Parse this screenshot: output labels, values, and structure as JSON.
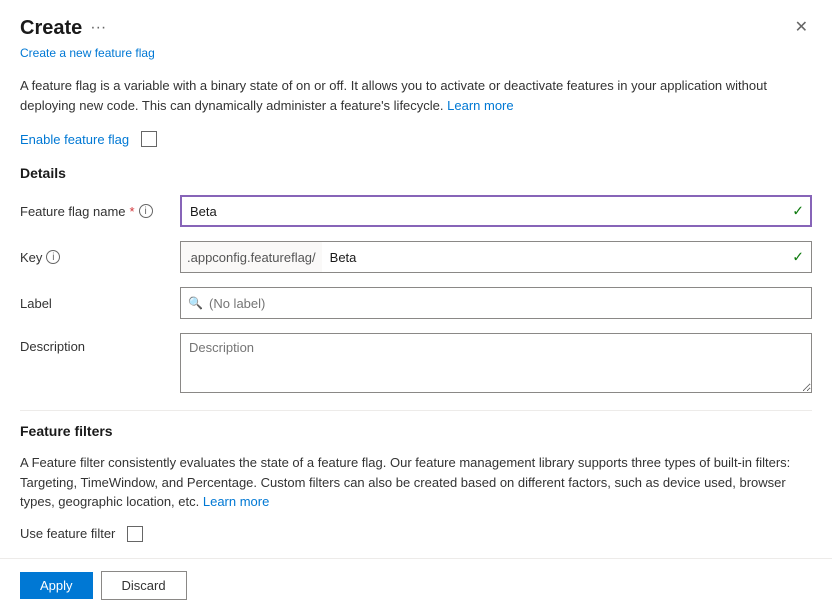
{
  "dialog": {
    "title": "Create",
    "subtitle": "Create a new feature flag",
    "more_icon": "···",
    "close_icon": "✕",
    "description": "A feature flag is a variable with a binary state of on or off. It allows you to activate or deactivate features in your application without deploying new code. This can dynamically administer a feature's lifecycle.",
    "learn_more_link": "Learn more",
    "enable_feature_flag_label": "Enable feature flag",
    "details_section": "Details",
    "feature_flag_name_label": "Feature flag name",
    "feature_flag_name_required": "*",
    "feature_flag_name_value": "Beta",
    "key_label": "Key",
    "key_prefix": ".appconfig.featureflag/",
    "key_value": "Beta",
    "label_label": "Label",
    "label_placeholder": "(No label)",
    "description_label": "Description",
    "description_placeholder": "Description",
    "feature_filters_title": "Feature filters",
    "feature_filters_description": "A Feature filter consistently evaluates the state of a feature flag. Our feature management library supports three types of built-in filters: Targeting, TimeWindow, and Percentage. Custom filters can also be created based on different factors, such as device used, browser types, geographic location, etc.",
    "feature_filters_learn_more": "Learn more",
    "use_feature_filter_label": "Use feature filter",
    "apply_button": "Apply",
    "discard_button": "Discard"
  }
}
